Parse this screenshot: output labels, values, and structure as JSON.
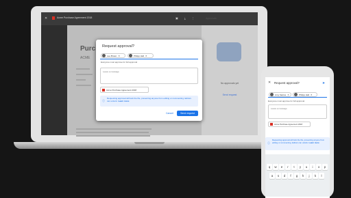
{
  "laptop": {
    "doc_tab_title": "Acme Purchase Agreement 2018",
    "side_panel_title": "Approvals",
    "doc_heading": "Purch",
    "doc_subheading": "ACME",
    "no_approvals_text": "No approvals yet",
    "send_request_link": "Send request"
  },
  "dialog": {
    "title": "Request approval?",
    "approvers": [
      "Lee Brown",
      "Philipp Hall"
    ],
    "required_note": "Everyone must approve for full approval",
    "message_placeholder": "Leave a message",
    "file_name": "Acme Purchase Agreement 2018",
    "info_text": "Requesting approval will lock the file, preventing anyone from editing or commenting. Editors can unlock.",
    "info_link": "Learn more",
    "cancel_label": "Cancel",
    "send_label": "Send request"
  },
  "phone": {
    "title": "Request approval?",
    "approvers": [
      "Amy Santos",
      "Philipp Hall"
    ],
    "required_note": "Everyone must approve for full approval",
    "message_placeholder": "Leave a message",
    "file_name": "Acme Purchase Agreement 2018",
    "info_text": "Requesting approval will lock the file, preventing anyone from editing or commenting. Editors can unlock.",
    "info_link": "Learn more",
    "keyboard_row1": [
      "q",
      "w",
      "e",
      "r",
      "t",
      "y",
      "u",
      "i",
      "o",
      "p"
    ],
    "keyboard_row2": [
      "a",
      "s",
      "d",
      "f",
      "g",
      "h",
      "j",
      "k",
      "l"
    ]
  },
  "colors": {
    "accent": "#1a73e8",
    "file_icon": "#d93025"
  }
}
